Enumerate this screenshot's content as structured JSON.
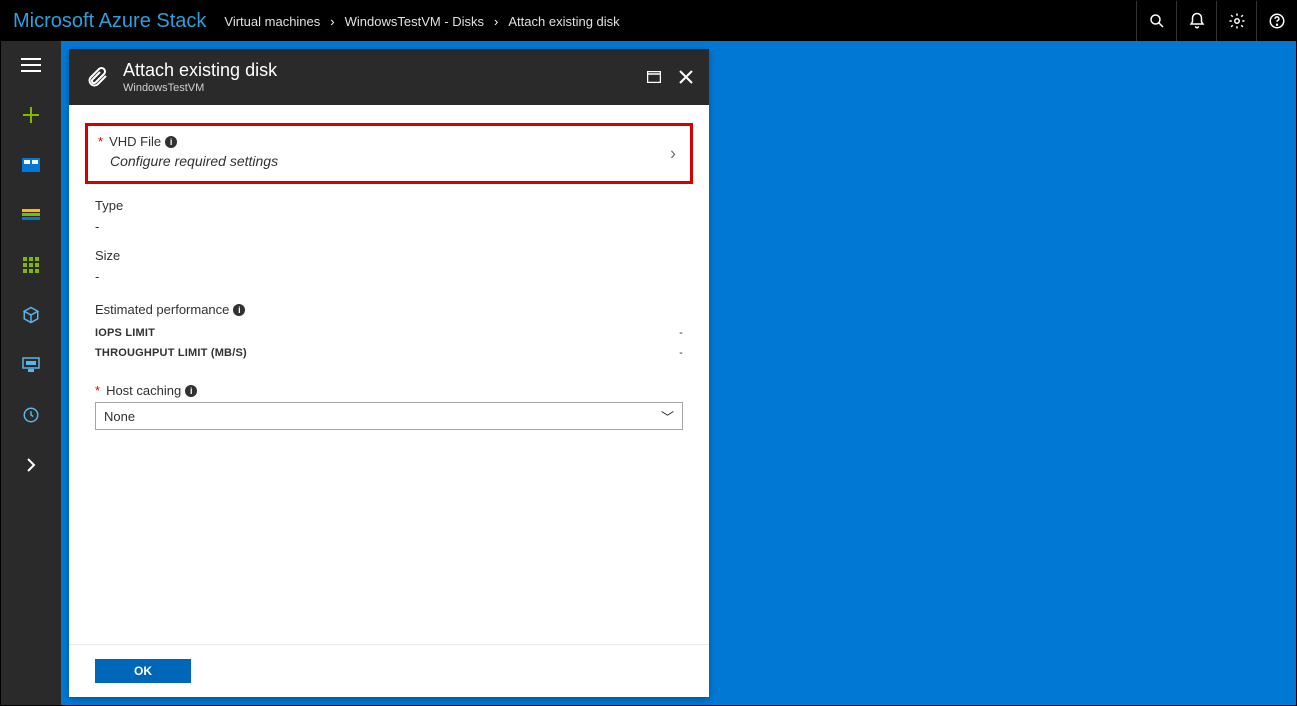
{
  "topbar": {
    "brand": "Microsoft Azure Stack",
    "breadcrumbs": [
      "Virtual machines",
      "WindowsTestVM - Disks",
      "Attach existing disk"
    ]
  },
  "blade": {
    "title": "Attach existing disk",
    "subtitle": "WindowsTestVM",
    "vhd": {
      "label": "VHD File",
      "placeholder": "Configure required settings"
    },
    "type": {
      "label": "Type",
      "value": "-"
    },
    "size": {
      "label": "Size",
      "value": "-"
    },
    "perf": {
      "label": "Estimated performance",
      "rows": [
        {
          "name": "IOPS LIMIT",
          "value": "-"
        },
        {
          "name": "THROUGHPUT LIMIT (MB/S)",
          "value": "-"
        }
      ]
    },
    "hostCaching": {
      "label": "Host caching",
      "value": "None"
    },
    "okLabel": "OK"
  }
}
